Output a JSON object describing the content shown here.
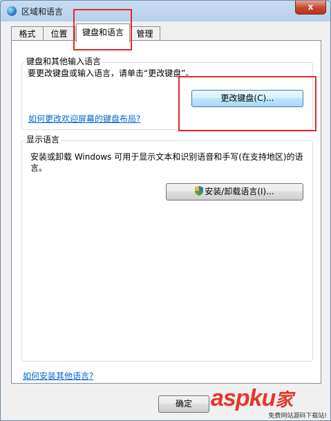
{
  "window": {
    "title": "区域和语言",
    "close_glyph": "x"
  },
  "tabs": [
    {
      "label": "格式"
    },
    {
      "label": "位置"
    },
    {
      "label": "键盘和语言",
      "active": true
    },
    {
      "label": "管理"
    }
  ],
  "keyboard_group": {
    "label": "键盘和其他输入语言",
    "description": "要更改键盘或输入语言，请单击“更改键盘”。",
    "button_label": "更改键盘(C)...",
    "link": "如何更改欢迎屏幕的键盘布局?"
  },
  "display_group": {
    "label": "显示语言",
    "description_line1": "安装或卸载 Windows 可用于显示文本和识别语音和手写(在支持地区)的语",
    "description_line2": "言。",
    "button_label": "安装/卸载语言(I)...",
    "button_icon": "uac-shield-icon"
  },
  "bottom_link": "如何安装其他语言?",
  "footer": {
    "ok_label": "确定"
  },
  "watermark": {
    "logo_text": "aspku",
    "logo_suffix": "家",
    "caption": "免费网站源码下载站!"
  },
  "colors": {
    "highlight": "#e0282a",
    "link": "#0066cc",
    "titlebar": "#b9d0ea"
  }
}
